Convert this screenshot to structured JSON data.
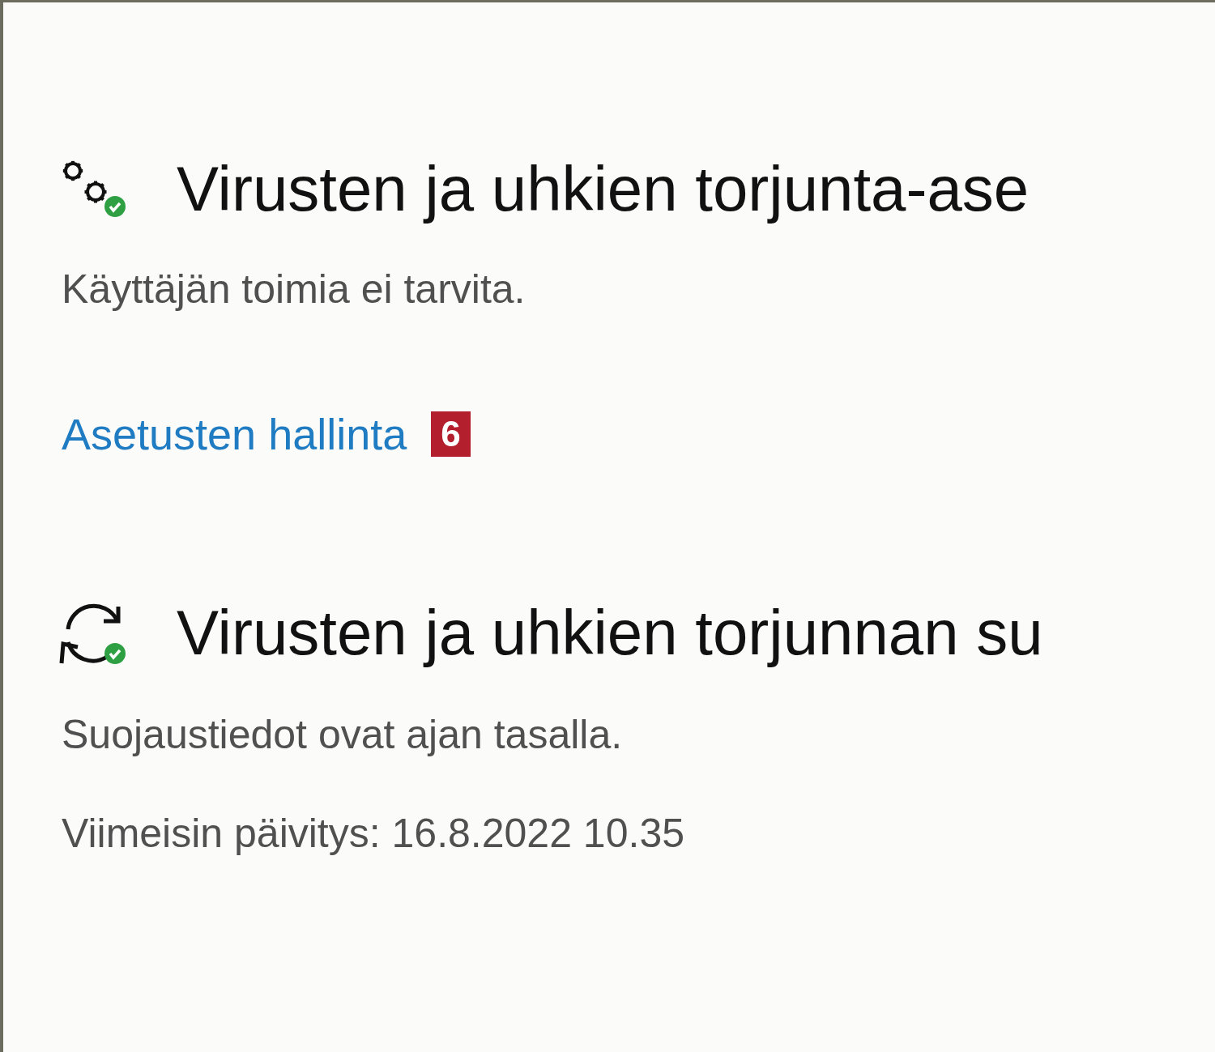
{
  "sections": [
    {
      "kind": "settings",
      "title": "Virusten ja uhkien torjunta-ase",
      "lines": [
        "Käyttäjän toimia ei tarvita."
      ],
      "link": "Asetusten hallinta",
      "badge": "6"
    },
    {
      "kind": "updates",
      "title": "Virusten ja uhkien torjunnan su",
      "lines": [
        "Suojaustiedot ovat ajan tasalla.",
        "Viimeisin päivitys: 16.8.2022 10.35"
      ]
    }
  ]
}
